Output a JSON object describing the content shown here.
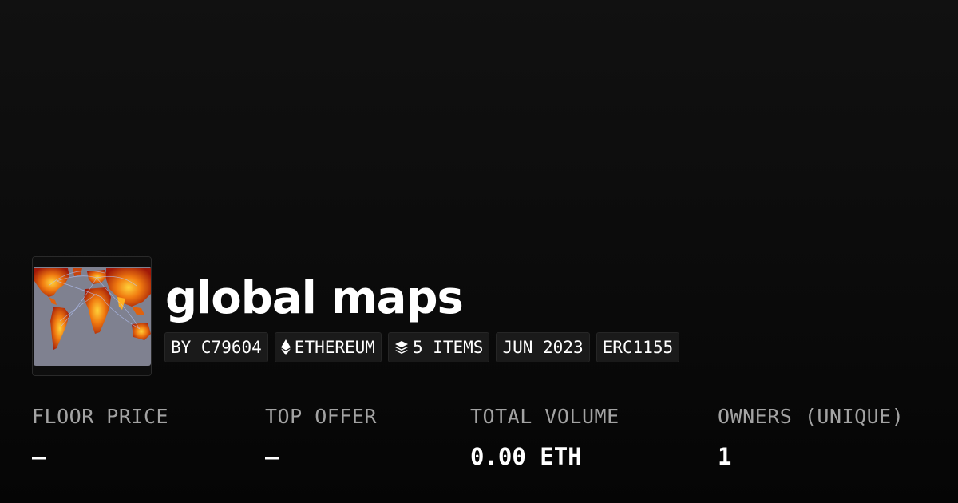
{
  "collection": {
    "title": "global maps",
    "image_alt_icon": "world-map-thumbnail"
  },
  "chips": {
    "creator": "BY C79604",
    "chain": "ETHEREUM",
    "chain_icon": "ethereum-icon",
    "items": "5 ITEMS",
    "items_icon": "layers-icon",
    "date": "JUN 2023",
    "standard": "ERC1155"
  },
  "stats": {
    "floor_price": {
      "label": "FLOOR PRICE",
      "value": "–"
    },
    "top_offer": {
      "label": "TOP OFFER",
      "value": "–"
    },
    "total_volume": {
      "label": "TOTAL VOLUME",
      "value": "0.00 ETH"
    },
    "owners": {
      "label": "OWNERS (UNIQUE)",
      "value": "1"
    }
  },
  "colors": {
    "background": "#0b0b0b",
    "chip_background": "#1a1a1a",
    "label_gray": "#a3a3a3",
    "text": "#ffffff"
  }
}
